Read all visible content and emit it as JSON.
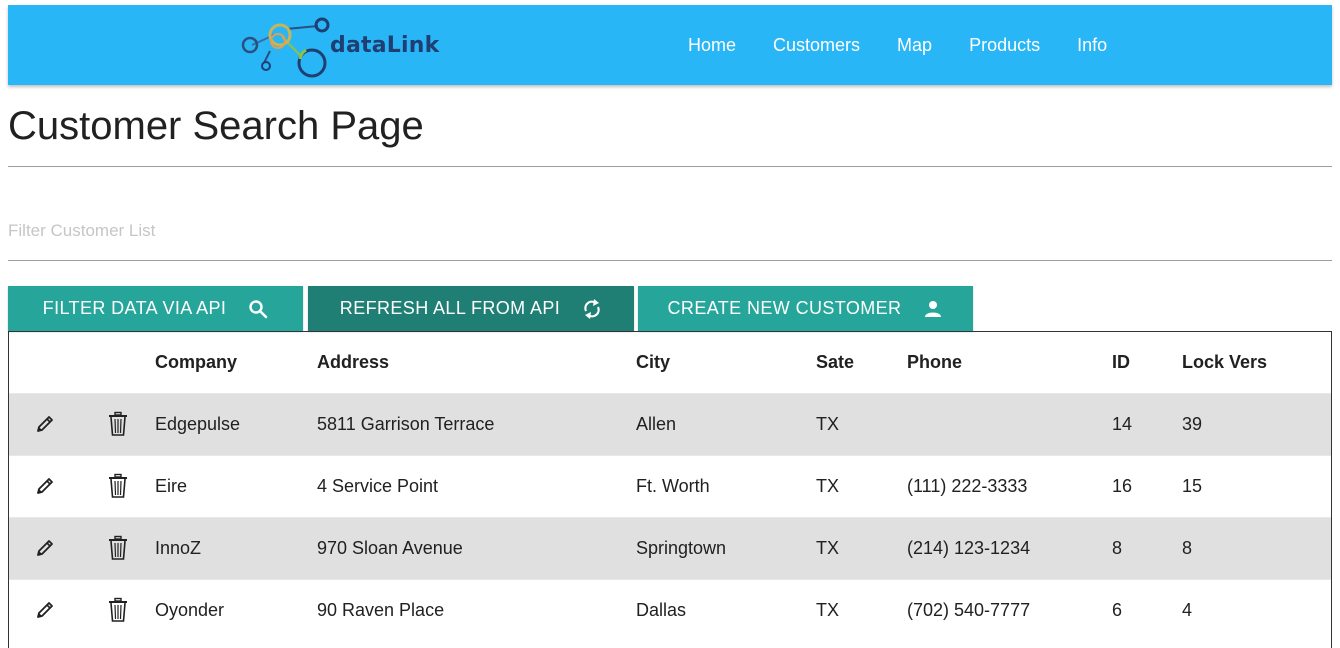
{
  "navbar": {
    "logo_text": "dataLink",
    "links": [
      "Home",
      "Customers",
      "Map",
      "Products",
      "Info"
    ]
  },
  "page": {
    "title": "Customer Search Page"
  },
  "filter": {
    "placeholder": "Filter Customer List",
    "value": ""
  },
  "buttons": {
    "filter_label": "FILTER DATA VIA API",
    "refresh_label": "REFRESH ALL FROM API",
    "create_label": "CREATE NEW CUSTOMER"
  },
  "table": {
    "columns": [
      "",
      "",
      "Company",
      "Address",
      "City",
      "Sate",
      "Phone",
      "ID",
      "Lock Vers"
    ],
    "rows": [
      {
        "company": "Edgepulse",
        "address": "5811 Garrison Terrace",
        "city": "Allen",
        "state": "TX",
        "phone": "",
        "id": "14",
        "lock": "39"
      },
      {
        "company": "Eire",
        "address": "4 Service Point",
        "city": "Ft. Worth",
        "state": "TX",
        "phone": "(111) 222-3333",
        "id": "16",
        "lock": "15"
      },
      {
        "company": "InnoZ",
        "address": "970 Sloan Avenue",
        "city": "Springtown",
        "state": "TX",
        "phone": "(214) 123-1234",
        "id": "8",
        "lock": "8"
      },
      {
        "company": "Oyonder",
        "address": "90 Raven Place",
        "city": "Dallas",
        "state": "TX",
        "phone": "(702) 540-7777",
        "id": "6",
        "lock": "4"
      }
    ]
  },
  "colors": {
    "navbar": "#29b6f6",
    "button": "#26a69a",
    "button_dark": "#1f7f75",
    "row_stripe": "#e0e0e0"
  },
  "icons": {
    "edit": "pencil-icon",
    "delete": "trash-icon",
    "filter": "search-icon",
    "refresh": "refresh-icon",
    "create": "person-icon"
  }
}
